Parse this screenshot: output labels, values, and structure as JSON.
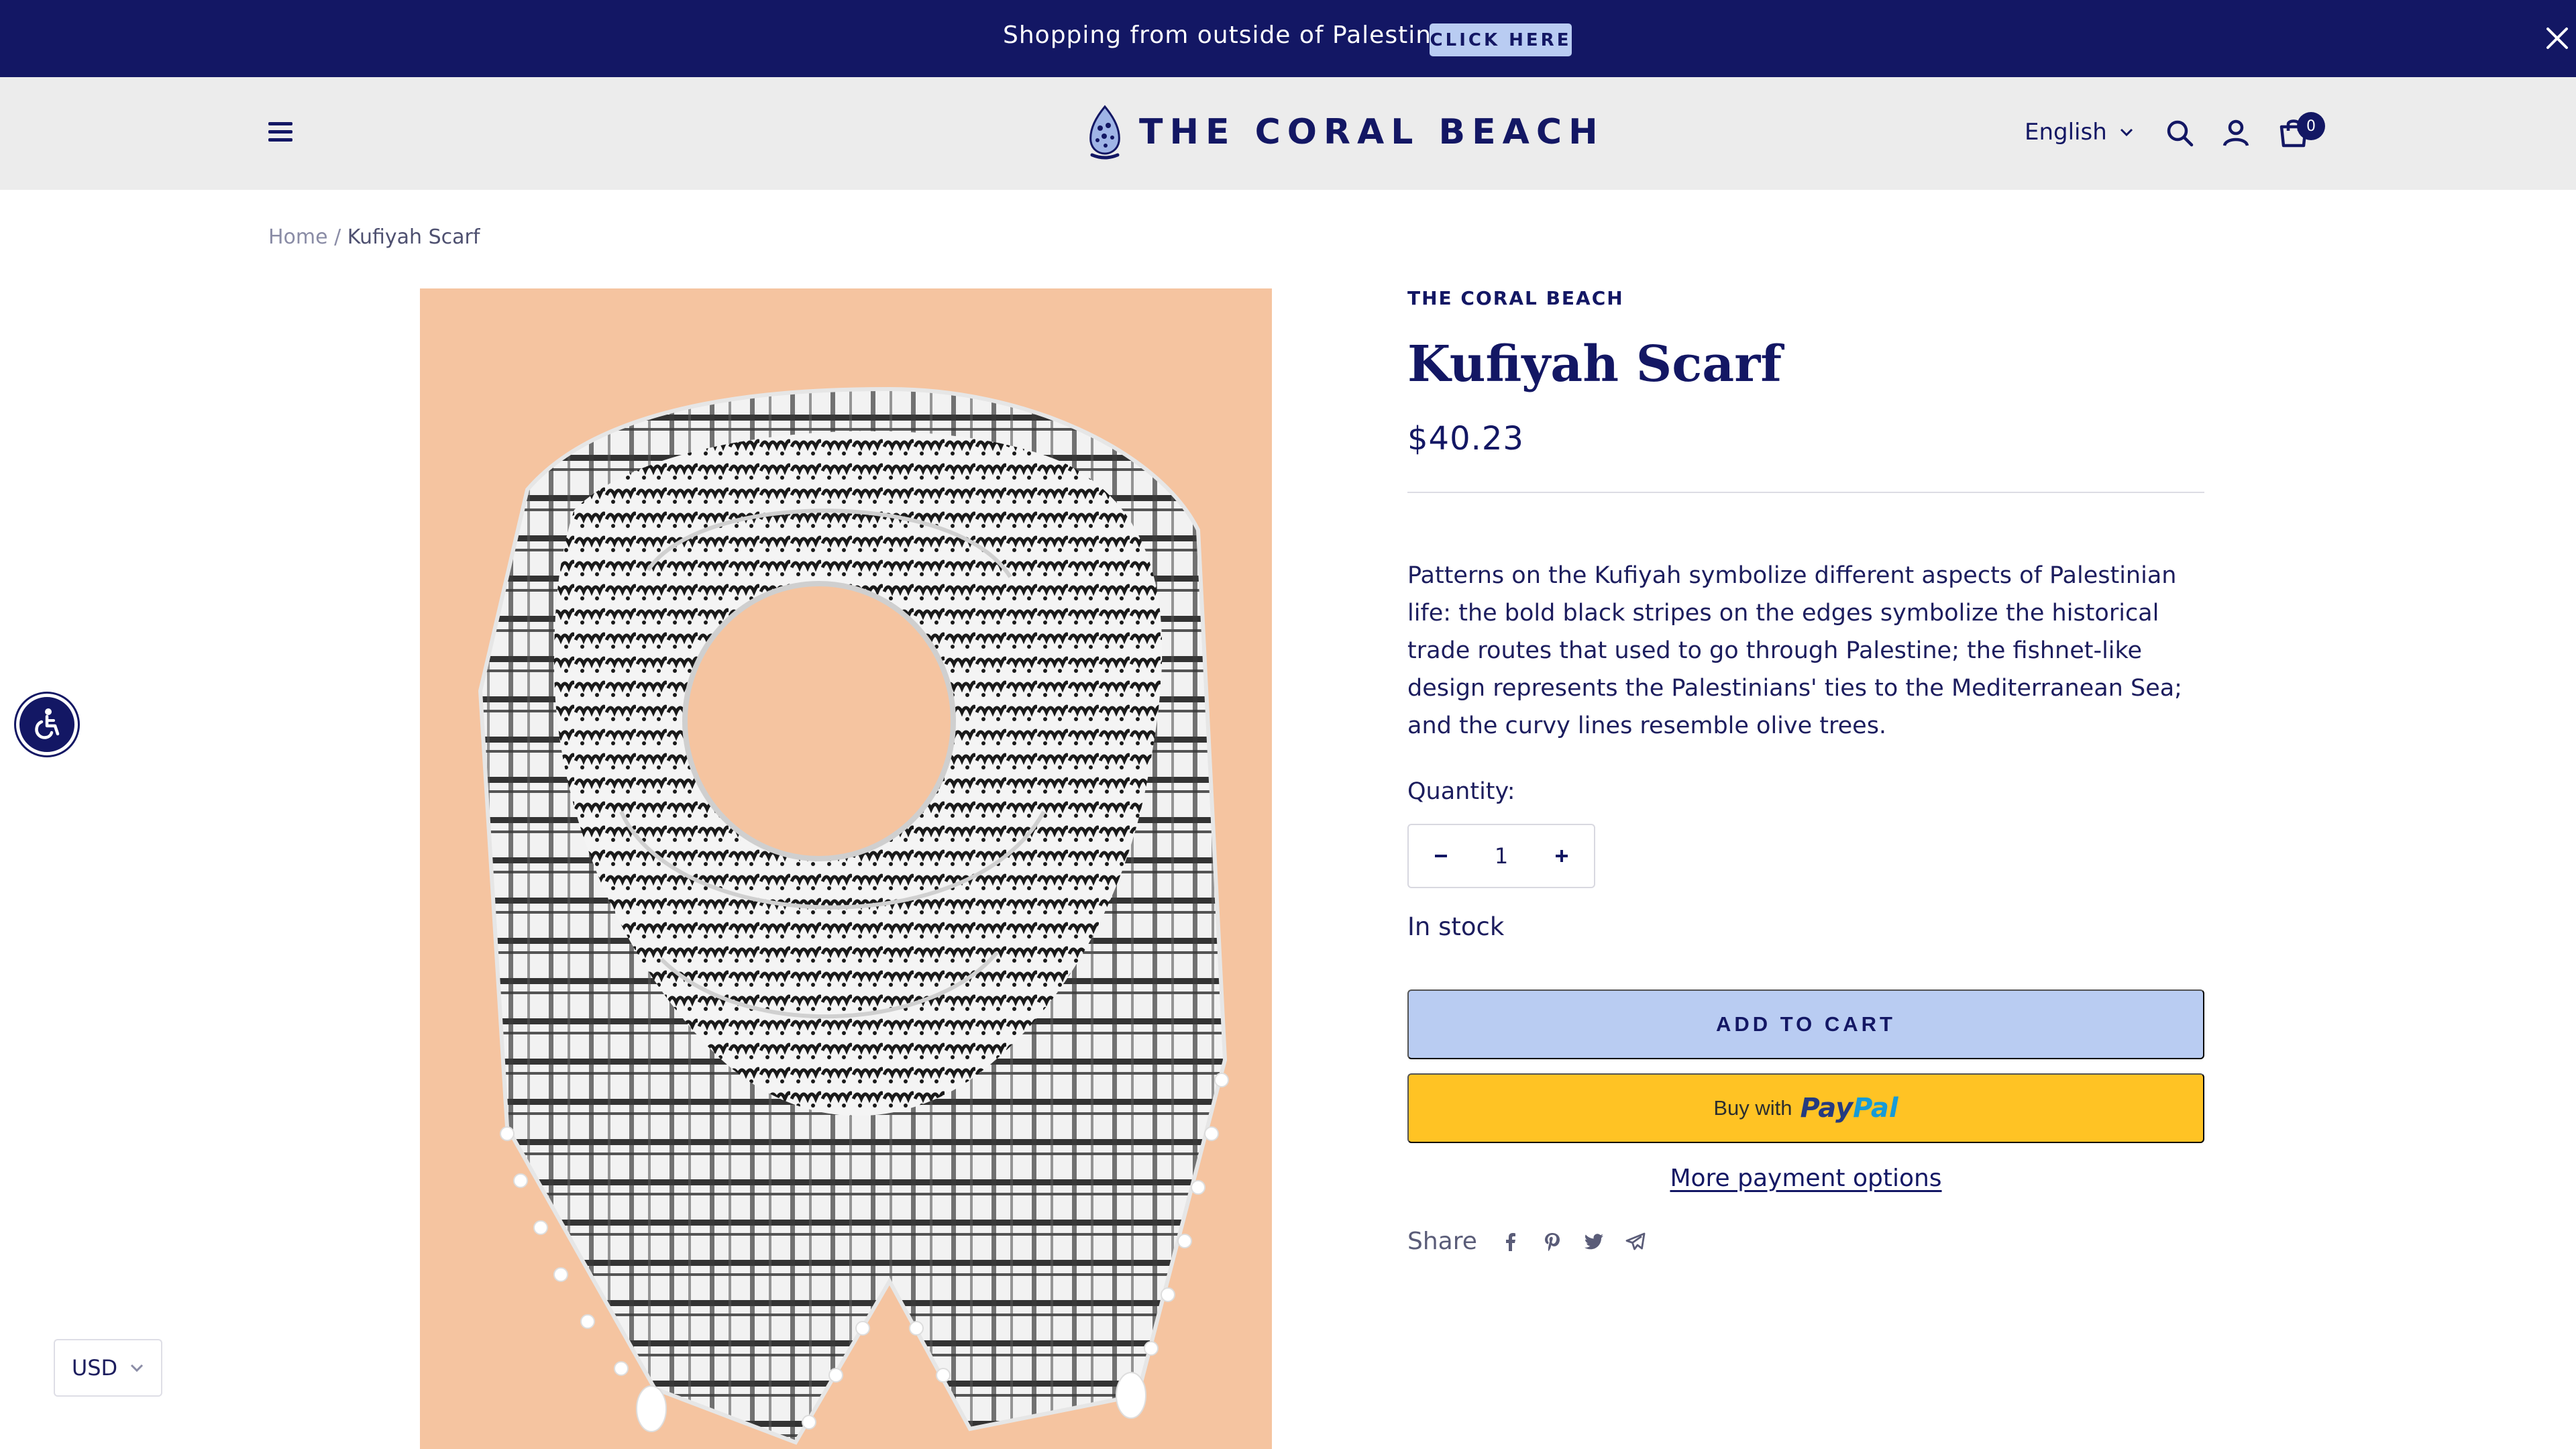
{
  "announcement": {
    "text": "Shopping from outside of Palestine?",
    "button_label": "CLICK HERE"
  },
  "header": {
    "brand": "THE CORAL BEACH",
    "language": "English",
    "cart_count": "0",
    "icons": [
      "hamburger-menu-icon",
      "search-icon",
      "account-icon",
      "cart-icon",
      "close-icon",
      "chevron-down-icon"
    ]
  },
  "breadcrumb": {
    "home": "Home",
    "separator": "/",
    "current": "Kufiyah Scarf"
  },
  "product": {
    "vendor": "THE CORAL BEACH",
    "title": "Kufiyah Scarf",
    "price": "$40.23",
    "description": "Patterns on the Kufiyah symbolize different aspects of Palestinian life: the bold black stripes on the edges symbolize the historical trade routes that used to go through Palestine; the fishnet-like design represents the Palestinians' ties to the Mediterranean Sea; and the curvy lines resemble olive trees.",
    "quantity_label": "Quantity:",
    "quantity_value": "1",
    "stock": "In stock",
    "add_to_cart": "ADD TO CART",
    "paypal_prefix": "Buy with",
    "paypal_brand_1": "Pay",
    "paypal_brand_2": "Pal",
    "more_payment": "More payment options",
    "share_label": "Share",
    "share_icons": [
      "facebook-icon",
      "pinterest-icon",
      "twitter-icon",
      "telegram-icon"
    ]
  },
  "currency": {
    "selected": "USD"
  },
  "colors": {
    "navy": "#131764",
    "light_blue": "#b9ccf2",
    "paypal_yellow": "#ffc324",
    "header_gray": "#ececec",
    "image_bg": "#f5c4a0"
  }
}
